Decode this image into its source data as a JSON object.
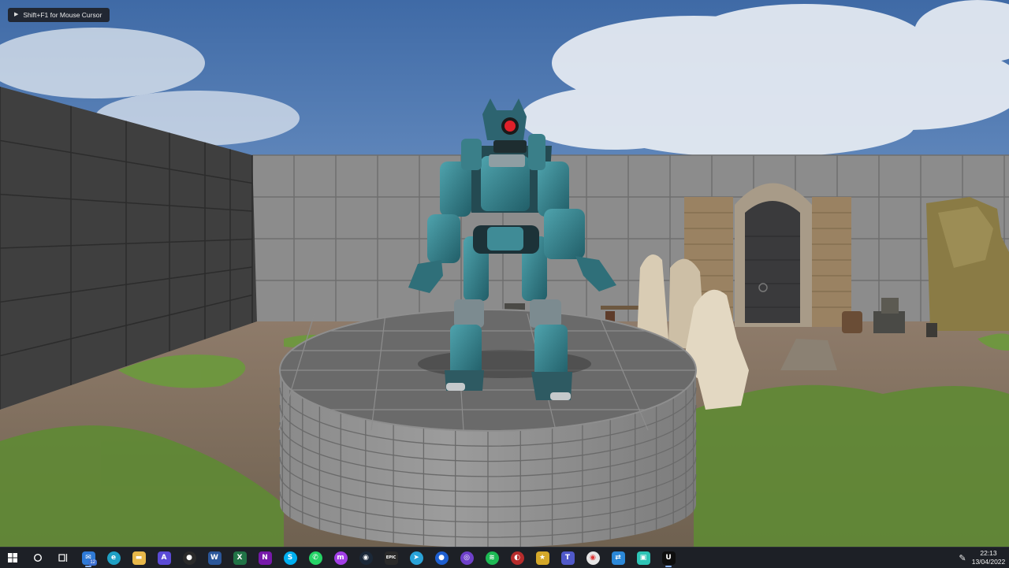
{
  "overlay": {
    "hint_text": "Shift+F1 for Mouse Cursor"
  },
  "taskbar": {
    "apps": [
      {
        "name": "start-button",
        "glyph": "",
        "color": ""
      },
      {
        "name": "search",
        "glyph": "",
        "color": ""
      },
      {
        "name": "task-view",
        "glyph": "",
        "color": ""
      },
      {
        "name": "mail",
        "glyph": "✉",
        "color": "#2f7ad6",
        "badge": "12",
        "active": true
      },
      {
        "name": "edge",
        "glyph": "e",
        "color": "#1fa0c4"
      },
      {
        "name": "file-explorer",
        "glyph": "▬",
        "color": "#e8b84a"
      },
      {
        "name": "affinity",
        "glyph": "A",
        "color": "#5b4bd6"
      },
      {
        "name": "obs",
        "glyph": "●",
        "color": "#2b2b2b"
      },
      {
        "name": "word",
        "glyph": "W",
        "color": "#2b579a"
      },
      {
        "name": "excel",
        "glyph": "X",
        "color": "#217346"
      },
      {
        "name": "onenote",
        "glyph": "N",
        "color": "#7719aa"
      },
      {
        "name": "skype",
        "glyph": "S",
        "color": "#00aff0"
      },
      {
        "name": "whatsapp",
        "glyph": "✆",
        "color": "#25d366"
      },
      {
        "name": "messenger",
        "glyph": "m",
        "color": "#a23ee6"
      },
      {
        "name": "steam",
        "glyph": "◉",
        "color": "#1b2838"
      },
      {
        "name": "epic-games",
        "glyph": "EPIC",
        "color": "#2a2a2a"
      },
      {
        "name": "telegram",
        "glyph": "➤",
        "color": "#2aa3d8"
      },
      {
        "name": "maps",
        "glyph": "●",
        "color": "#1e5fd0"
      },
      {
        "name": "github",
        "glyph": "◎",
        "color": "#6e40c9"
      },
      {
        "name": "spotify",
        "glyph": "≋",
        "color": "#1db954"
      },
      {
        "name": "davinci",
        "glyph": "◐",
        "color": "#b72c2c"
      },
      {
        "name": "star-app",
        "glyph": "★",
        "color": "#d4a82a"
      },
      {
        "name": "teams",
        "glyph": "T",
        "color": "#5059c9"
      },
      {
        "name": "chrome",
        "glyph": "◉",
        "color": "#e6e6e6"
      },
      {
        "name": "remote-app",
        "glyph": "⇄",
        "color": "#2b88d8"
      },
      {
        "name": "qt-app",
        "glyph": "▣",
        "color": "#2ec4b6"
      },
      {
        "name": "unreal-engine",
        "glyph": "U",
        "color": "#0e0e0e",
        "active": true
      }
    ],
    "time": "22:13",
    "date": "13/04/2022"
  }
}
